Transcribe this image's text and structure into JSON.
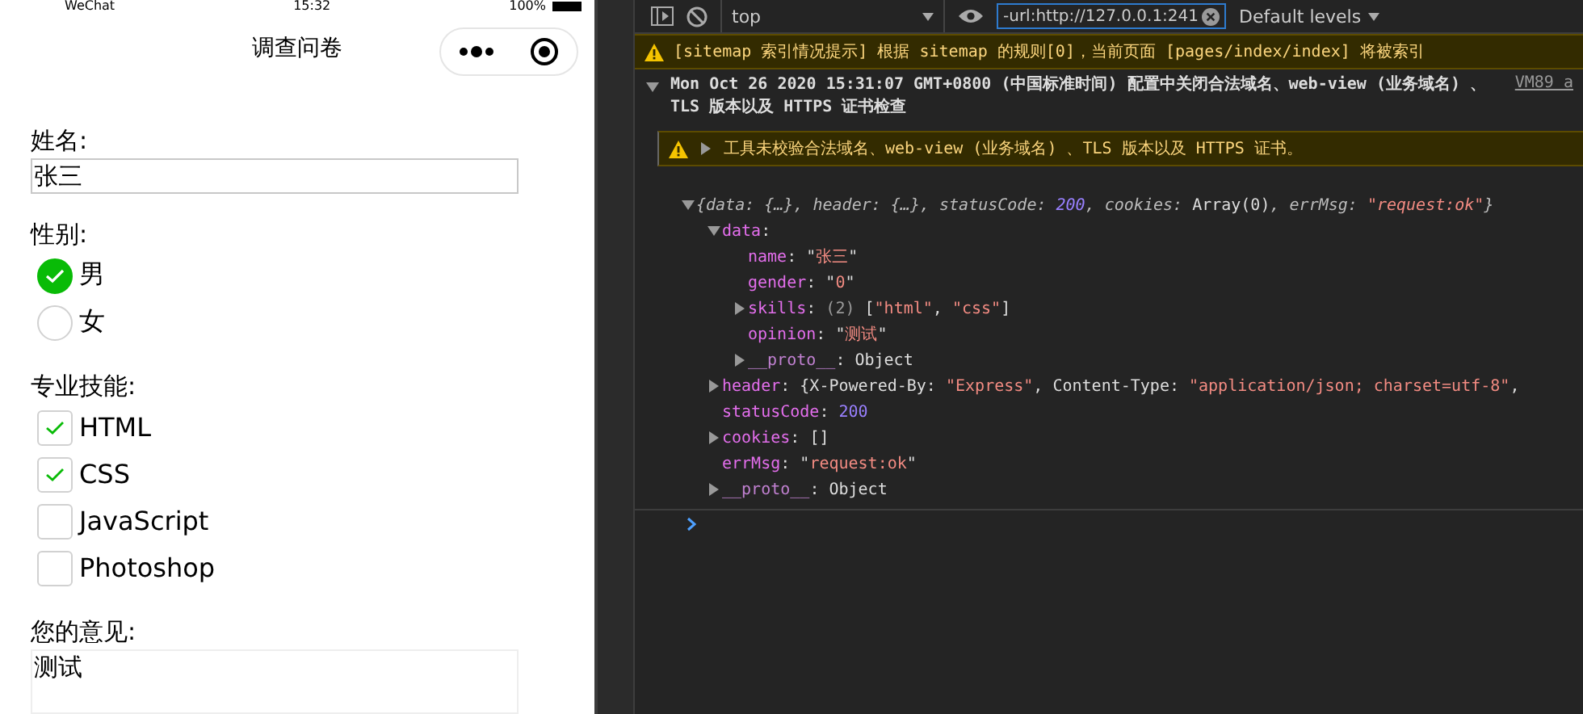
{
  "phone": {
    "status_bar": {
      "carrier": "WeChat",
      "time": "15:32",
      "battery": "100%"
    },
    "nav_title": "调查问卷",
    "form": [
      {
        "kind": "text",
        "label": "姓名:",
        "value": "张三"
      },
      {
        "kind": "radio",
        "label": "性别:",
        "options": [
          {
            "label": "男",
            "selected": true
          },
          {
            "label": "女",
            "selected": false
          }
        ]
      },
      {
        "kind": "checkbox",
        "label": "专业技能:",
        "options": [
          {
            "label": "HTML",
            "checked": true
          },
          {
            "label": "CSS",
            "checked": true
          },
          {
            "label": "JavaScript",
            "checked": false
          },
          {
            "label": "Photoshop",
            "checked": false
          }
        ]
      },
      {
        "kind": "textarea",
        "label": "您的意见:",
        "value": "测试"
      }
    ]
  },
  "devtools": {
    "toolbar": {
      "context": "top",
      "filter": "-url:http://127.0.0.1:241",
      "levels": "Default levels"
    },
    "messages": [
      {
        "kind": "warning",
        "text": "[sitemap 索引情况提示] 根据 sitemap 的规则[0]，当前页面 [pages/index/index] 将被索引"
      },
      {
        "kind": "group",
        "expanded": true,
        "text": "Mon Oct 26 2020 15:31:07 GMT+0800 (中国标准时间) 配置中关闭合法域名、web-view (业务域名) 、TLS 版本以及 HTTPS 证书检查",
        "source": "VM89 a"
      },
      {
        "kind": "nested-warning",
        "expanded": false,
        "text": "工具未校验合法域名、web-view (业务域名) 、TLS 版本以及 HTTPS 证书。"
      }
    ],
    "object": {
      "expanded": true,
      "parts": [
        {
          "kind": "preview",
          "text": "{data: {…}, header: {…}, statusCode: "
        },
        {
          "kind": "number",
          "text": "200"
        },
        {
          "kind": "preview",
          "text": ", cookies: "
        },
        {
          "kind": "plain",
          "text": "Array(0)"
        },
        {
          "kind": "preview",
          "text": ", errMsg: "
        },
        {
          "kind": "string",
          "text": "\"request:ok\""
        },
        {
          "kind": "preview",
          "text": "}"
        }
      ],
      "children": [
        {
          "expanded": true,
          "parts": [
            {
              "kind": "key",
              "text": "data"
            },
            {
              "kind": "plain",
              "text": ":"
            }
          ],
          "children": [
            {
              "parts": [
                {
                  "kind": "key",
                  "text": "name"
                },
                {
                  "kind": "plain",
                  "text": ": \""
                },
                {
                  "kind": "string",
                  "text": "张三"
                },
                {
                  "kind": "plain",
                  "text": "\""
                }
              ]
            },
            {
              "parts": [
                {
                  "kind": "key",
                  "text": "gender"
                },
                {
                  "kind": "plain",
                  "text": ": \""
                },
                {
                  "kind": "string",
                  "text": "0"
                },
                {
                  "kind": "plain",
                  "text": "\""
                }
              ]
            },
            {
              "expanded": false,
              "parts": [
                {
                  "kind": "key",
                  "text": "skills"
                },
                {
                  "kind": "plain",
                  "text": ": "
                },
                {
                  "kind": "count",
                  "text": "(2)"
                },
                {
                  "kind": "plain",
                  "text": " ["
                },
                {
                  "kind": "string",
                  "text": "\"html\""
                },
                {
                  "kind": "plain",
                  "text": ", "
                },
                {
                  "kind": "string",
                  "text": "\"css\""
                },
                {
                  "kind": "plain",
                  "text": "]"
                }
              ]
            },
            {
              "parts": [
                {
                  "kind": "key",
                  "text": "opinion"
                },
                {
                  "kind": "plain",
                  "text": ": \""
                },
                {
                  "kind": "string",
                  "text": "测试"
                },
                {
                  "kind": "plain",
                  "text": "\""
                }
              ]
            },
            {
              "expanded": false,
              "parts": [
                {
                  "kind": "proto",
                  "text": "__proto__"
                },
                {
                  "kind": "plain",
                  "text": ": Object"
                }
              ]
            }
          ]
        },
        {
          "expanded": false,
          "parts": [
            {
              "kind": "key",
              "text": "header"
            },
            {
              "kind": "plain",
              "text": ": {X-Powered-By: "
            },
            {
              "kind": "string",
              "text": "\"Express\""
            },
            {
              "kind": "plain",
              "text": ", Content-Type: "
            },
            {
              "kind": "string",
              "text": "\"application/json; charset=utf-8\""
            },
            {
              "kind": "plain",
              "text": ","
            }
          ]
        },
        {
          "parts": [
            {
              "kind": "key",
              "text": "statusCode"
            },
            {
              "kind": "plain",
              "text": ": "
            },
            {
              "kind": "number",
              "text": "200"
            }
          ]
        },
        {
          "expanded": false,
          "parts": [
            {
              "kind": "key",
              "text": "cookies"
            },
            {
              "kind": "plain",
              "text": ": []"
            }
          ]
        },
        {
          "parts": [
            {
              "kind": "key",
              "text": "errMsg"
            },
            {
              "kind": "plain",
              "text": ": \""
            },
            {
              "kind": "string",
              "text": "request:ok"
            },
            {
              "kind": "plain",
              "text": "\""
            }
          ]
        },
        {
          "expanded": false,
          "parts": [
            {
              "kind": "proto",
              "text": "__proto__"
            },
            {
              "kind": "plain",
              "text": ": Object"
            }
          ]
        }
      ]
    }
  }
}
